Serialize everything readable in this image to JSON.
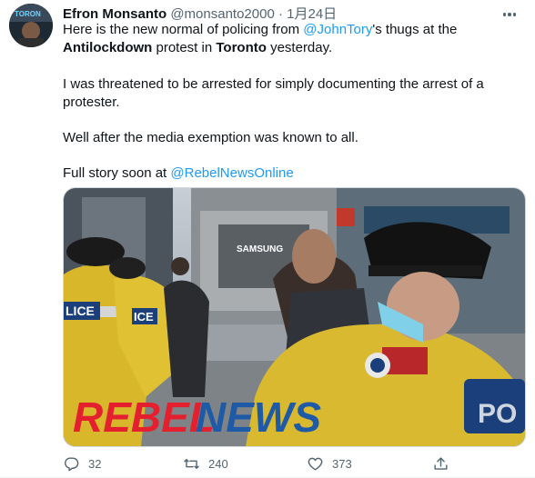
{
  "tweet": {
    "author_name": "Efron Monsanto",
    "handle": "@monsanto2000",
    "separator": "·",
    "time": "1月24日",
    "text": {
      "l1_a": "Here is the new normal of policing from ",
      "l1_mention": "@JohnTory",
      "l1_b": "'s thugs at the",
      "l2_bold1": "Antilockdown",
      "l2_a": " protest in ",
      "l2_bold2": "Toronto",
      "l2_b": " yesterday.",
      "p2": "I was threatened to be arrested for simply documenting the arrest of a protester.",
      "p3": "Well after the media exemption was known to all.",
      "p4_a": "Full story soon at ",
      "p4_mention": "@RebelNewsOnline"
    }
  },
  "media": {
    "watermark_part1": "REBEL",
    "watermark_part2": "NEWS",
    "store_sign": "SAMSUNG",
    "vest_text_left": "LICE",
    "vest_text_mid": "ICE",
    "vest_text_right": "PO",
    "avatar_text": "TORON"
  },
  "actions": {
    "replies": "32",
    "retweets": "240",
    "likes": "373"
  },
  "icons": [
    "more-icon",
    "reply-icon",
    "retweet-icon",
    "like-icon",
    "share-icon"
  ],
  "colors": {
    "link": "#1d9bf0",
    "secondary_text": "#536471",
    "watermark_red": "#e4202f",
    "watermark_blue": "#1f5aa6",
    "police_yellow": "#e6c22f"
  }
}
